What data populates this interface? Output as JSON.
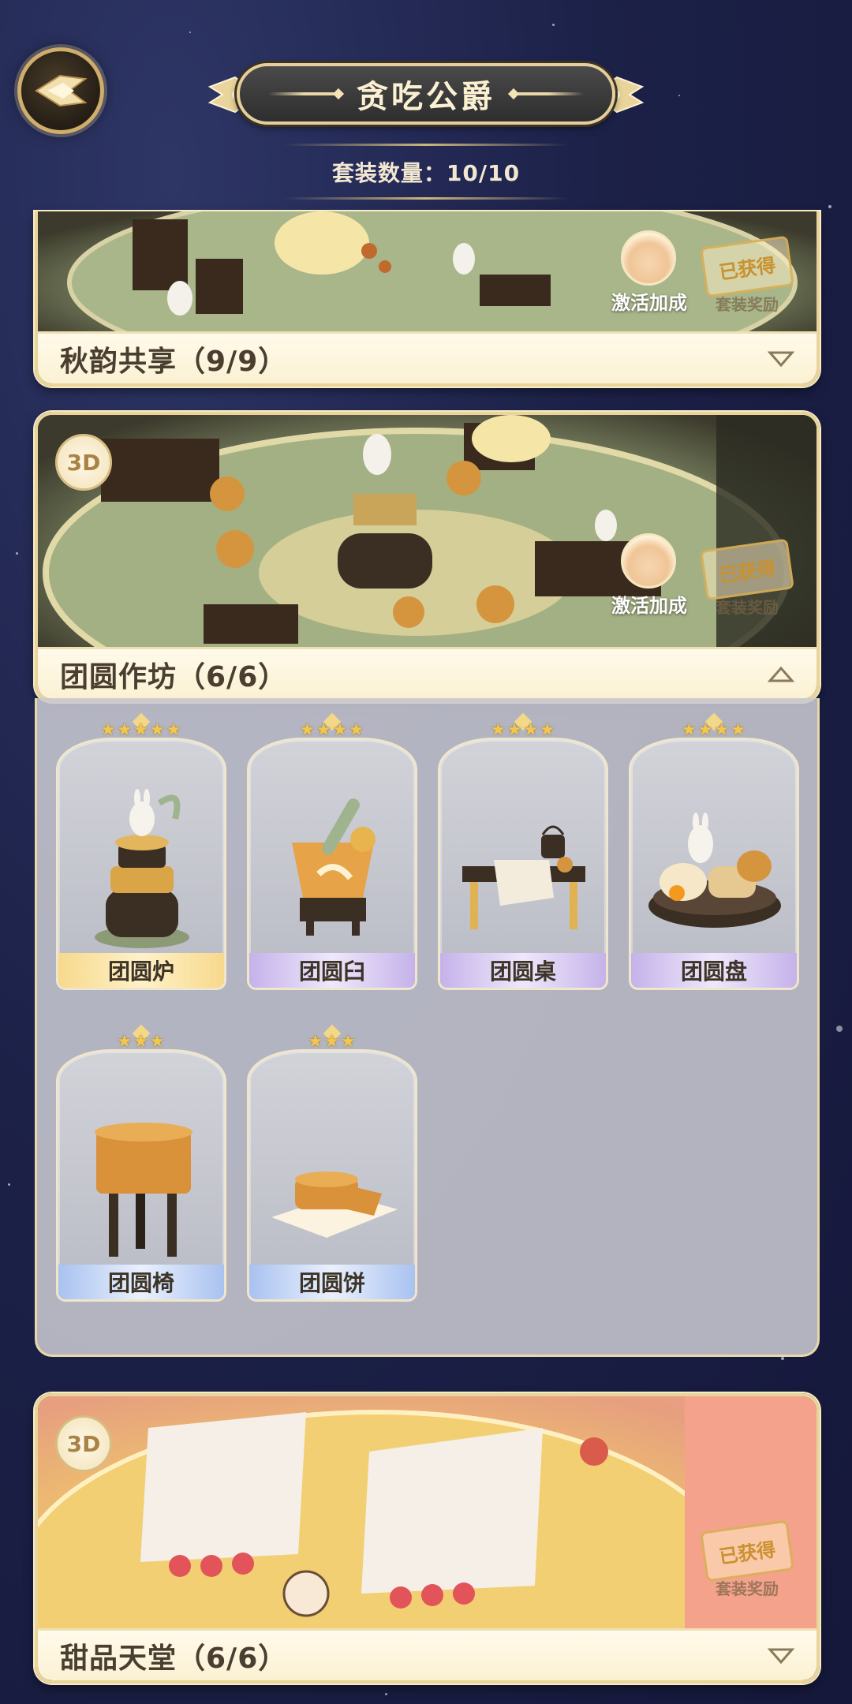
{
  "header": {
    "title": "贪吃公爵",
    "count_label": "套装数量：10/10"
  },
  "suits": [
    {
      "name": "秋韵共享（9/9）",
      "expanded": false,
      "has_3d": false,
      "bonus_label": "激活加成",
      "stamp": "已获得",
      "reward_label": "套装奖励"
    },
    {
      "name": "团圆作坊（6/6）",
      "expanded": true,
      "has_3d": true,
      "badge_3d": "3D",
      "bonus_label": "激活加成",
      "stamp": "已获得",
      "reward_label": "套装奖励"
    },
    {
      "name": "甜品天堂（6/6）",
      "expanded": false,
      "has_3d": true,
      "badge_3d": "3D",
      "stamp": "已获得",
      "reward_label": "套装奖励"
    }
  ],
  "items": [
    {
      "name": "团圆炉",
      "stars": "★★★★★",
      "rarity": "gold"
    },
    {
      "name": "团圆臼",
      "stars": "★★★★",
      "rarity": "purple"
    },
    {
      "name": "团圆桌",
      "stars": "★★★★",
      "rarity": "purple"
    },
    {
      "name": "团圆盘",
      "stars": "★★★★",
      "rarity": "purple"
    },
    {
      "name": "团圆椅",
      "stars": "★★★",
      "rarity": "blue"
    },
    {
      "name": "团圆饼",
      "stars": "★★★",
      "rarity": "blue"
    }
  ],
  "colors": {
    "accent_gold": "#e9d49b",
    "star_gold": "#f2c750"
  }
}
